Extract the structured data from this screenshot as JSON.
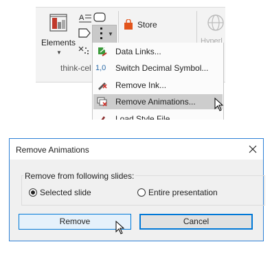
{
  "ribbon": {
    "elements_label": "Elements",
    "group_label": "think-cel",
    "store_label": "Store",
    "hyperlink_label": "Hyperl",
    "icons": [
      "elements-icon",
      "text-a-icon",
      "rounded-rect-icon",
      "pentagon-icon",
      "ellipsis-more-icon",
      "store-bag-icon",
      "hyperlink-globe-icon"
    ]
  },
  "menu": {
    "items": [
      {
        "label": "Data Links...",
        "icon": "data-links-icon"
      },
      {
        "label": "Switch Decimal Symbol...",
        "icon": "decimal-symbol-icon",
        "icon_text": "1,0"
      },
      {
        "label": "Remove Ink...",
        "icon": "remove-ink-icon"
      },
      {
        "label": "Remove Animations...",
        "icon": "remove-animations-icon",
        "highlighted": true
      },
      {
        "label": "Load Style File...",
        "icon": "load-style-icon"
      }
    ]
  },
  "dialog": {
    "title": "Remove Animations",
    "group_label": "Remove from following slides:",
    "options": [
      {
        "label": "Selected slide",
        "selected": true
      },
      {
        "label": "Entire presentation",
        "selected": false
      }
    ],
    "remove_label": "Remove",
    "cancel_label": "Cancel"
  },
  "colors": {
    "accent_blue": "#0078d7",
    "dialog_border": "#2b7fd6",
    "menu_highlight": "#cdcdcd",
    "store_orange": "#e2541c"
  }
}
